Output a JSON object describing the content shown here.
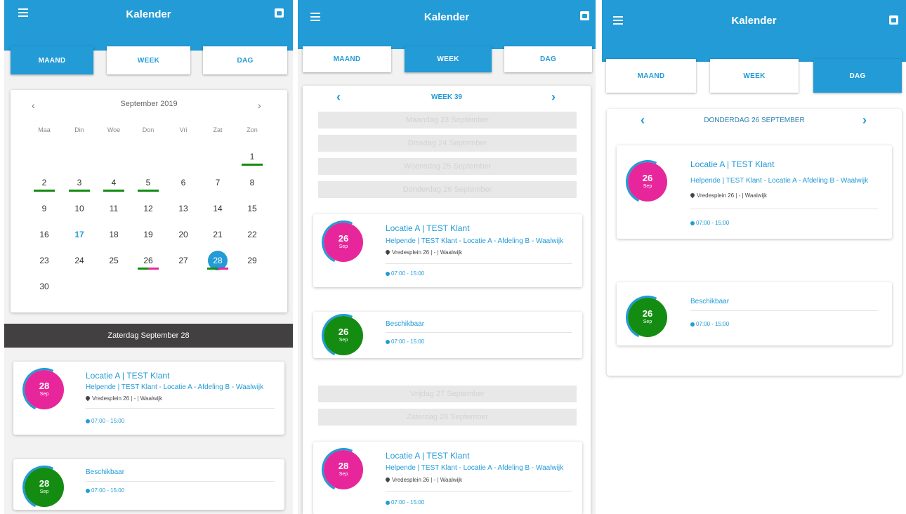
{
  "app": {
    "title": "Kalender"
  },
  "tabs": {
    "month": "MAAND",
    "week": "WEEK",
    "day": "DAG"
  },
  "colors": {
    "primary": "#229bd6",
    "pink": "#e8269b",
    "green": "#148c12",
    "dark": "#424040"
  },
  "month_view": {
    "month_label": "September 2019",
    "prev": "‹",
    "next": "›",
    "weekdays": [
      "Maa",
      "Din",
      "Woe",
      "Don",
      "Vri",
      "Zat",
      "Zon"
    ],
    "weeks": [
      [
        "",
        "",
        "",
        "",
        "",
        "",
        "1"
      ],
      [
        "2",
        "3",
        "4",
        "5",
        "6",
        "7",
        "8"
      ],
      [
        "9",
        "10",
        "11",
        "12",
        "13",
        "14",
        "15"
      ],
      [
        "16",
        "17",
        "18",
        "19",
        "20",
        "21",
        "22"
      ],
      [
        "23",
        "24",
        "25",
        "26",
        "27",
        "28",
        "29"
      ],
      [
        "30",
        "",
        "",
        "",
        "",
        "",
        ""
      ]
    ],
    "today": "17",
    "selected": "28",
    "selected_day_header": "Zaterdag September 28",
    "events": [
      {
        "day": "28",
        "month": "Sep",
        "color": "pink",
        "title": "Locatie A | TEST Klant",
        "subtitle": "Helpende | TEST Klant - Locatie A - Afdeling B - Waalwijk",
        "address": "Vredesplein 26 | - | Waalwijk",
        "time": "07:00 - 15:00"
      },
      {
        "day": "28",
        "month": "Sep",
        "color": "green",
        "title": "Beschikbaar",
        "time": "07:00 - 15:00"
      }
    ]
  },
  "week_view": {
    "label": "WEEK 39",
    "prev": "‹",
    "next": "›",
    "empty_days_top": [
      "Maandag 23 September",
      "Dinsdag 24 September",
      "Woensdag 25 September",
      "Donderdag 26 September"
    ],
    "empty_days_bottom": [
      "Vrijdag 27 September",
      "Zaterdag 28 September"
    ],
    "events_26": [
      {
        "day": "26",
        "month": "Sep",
        "color": "pink",
        "title": "Locatie A | TEST Klant",
        "subtitle": "Helpende | TEST Klant - Locatie A - Afdeling B - Waalwijk",
        "address": "Vredesplein 26 | - | Waalwijk",
        "time": "07:00 - 15:00"
      },
      {
        "day": "26",
        "month": "Sep",
        "color": "green",
        "title": "Beschikbaar",
        "time": "07:00 - 15:00"
      }
    ],
    "events_28": [
      {
        "day": "28",
        "month": "Sep",
        "color": "pink",
        "title": "Locatie A | TEST Klant",
        "subtitle": "Helpende | TEST Klant - Locatie A - Afdeling B - Waalwijk",
        "address": "Vredesplein 26 | - | Waalwijk",
        "time": "07:00 - 15:00"
      }
    ]
  },
  "day_view": {
    "label": "DONDERDAG 26 SEPTEMBER",
    "prev": "‹",
    "next": "›",
    "events": [
      {
        "day": "26",
        "month": "Sep",
        "color": "pink",
        "title": "Locatie A | TEST Klant",
        "subtitle": "Helpende | TEST Klant - Locatie A - Afdeling B - Waalwijk",
        "address": "Vredesplein 26 | - | Waalwijk",
        "time": "07:00 - 15:00"
      },
      {
        "day": "26",
        "month": "Sep",
        "color": "green",
        "title": "Beschikbaar",
        "time": "07:00 - 15:00"
      }
    ]
  }
}
